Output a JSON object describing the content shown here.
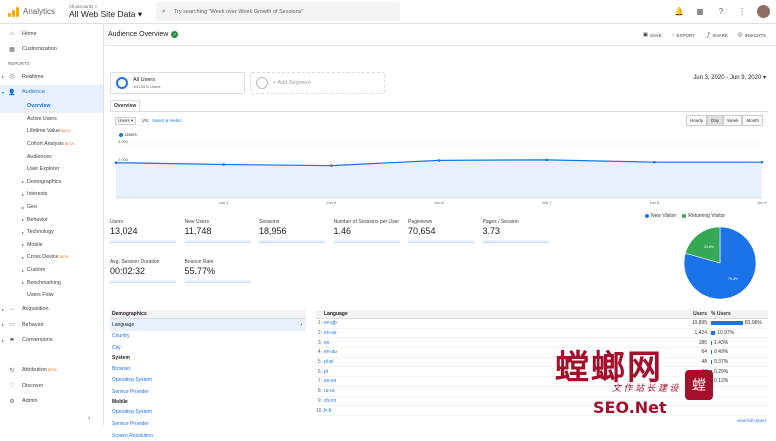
{
  "app": {
    "name": "Analytics",
    "account_path": "All accounts >",
    "view": "All Web Site Data",
    "search_placeholder": "Try searching \"Week over Week Growth of Sessions\""
  },
  "topicons": {
    "bell": "🔔",
    "grid": "▦",
    "help": "?",
    "more": "⋮"
  },
  "sidebar": {
    "top": [
      {
        "label": "Home",
        "icon": "⌂"
      },
      {
        "label": "Customization",
        "icon": "▦"
      }
    ],
    "reports_label": "REPORTS",
    "realtime": {
      "label": "Realtime",
      "icon": "◷"
    },
    "audience": {
      "label": "Audience",
      "icon": "👤"
    },
    "audience_items": [
      "Overview",
      "Active Users",
      "Lifetime Value",
      "Cohort Analysis",
      "Audiences",
      "User Explorer",
      "Demographics",
      "Interests",
      "Geo",
      "Behavior",
      "Technology",
      "Mobile",
      "Cross Device",
      "Custom",
      "Benchmarking",
      "Users Flow"
    ],
    "beta": "BETA",
    "others": [
      {
        "label": "Acquisition",
        "icon": "→"
      },
      {
        "label": "Behavior",
        "icon": "▭"
      },
      {
        "label": "Conversions",
        "icon": "⚑"
      }
    ],
    "bottom": [
      {
        "label": "Attribution",
        "icon": "↻"
      },
      {
        "label": "Discover",
        "icon": "♡"
      },
      {
        "label": "Admin",
        "icon": "⚙"
      }
    ]
  },
  "header": {
    "title": "Audience Overview",
    "check": "✓",
    "actions": [
      "SAVE",
      "EXPORT",
      "SHARE",
      "INSIGHTS"
    ],
    "action_icons": [
      "▣",
      "↓",
      "⤴",
      "◎"
    ]
  },
  "segments": {
    "all_users": "All Users",
    "all_users_pct": "100.00% Users",
    "add": "+ Add Segment"
  },
  "date_range": "Jun 3, 2020 - Jun 9, 2020",
  "tab": "Overview",
  "chart_controls": {
    "metric": "Users ▾",
    "vs": "VS.",
    "select_metric": "Select a metric",
    "granularity": [
      "Hourly",
      "Day",
      "Week",
      "Month"
    ],
    "legend": "Users"
  },
  "chart_data": {
    "type": "line",
    "x": [
      "Jun 3",
      "Jun 4",
      "Jun 5",
      "Jun 6",
      "Jun 7",
      "Jun 8",
      "Jun 9"
    ],
    "series": [
      {
        "name": "Users",
        "values": [
          1960,
          1860,
          1800,
          2090,
          2120,
          1990,
          1990
        ]
      }
    ],
    "yticks": [
      "3,000",
      "2,000",
      "1,000"
    ],
    "xticks": [
      "Jun 4",
      "Jun 5",
      "Jun 6",
      "Jun 7",
      "Jun 8",
      "Jun 9"
    ],
    "ylim": [
      0,
      3000
    ],
    "color": "#1a73e8"
  },
  "metrics": [
    {
      "label": "Users",
      "value": "13,024"
    },
    {
      "label": "New Users",
      "value": "11,748"
    },
    {
      "label": "Sessions",
      "value": "18,956"
    },
    {
      "label": "Number of Sessions per User",
      "value": "1.46"
    },
    {
      "label": "Pageviews",
      "value": "70,654"
    },
    {
      "label": "Pages / Session",
      "value": "3.73"
    },
    {
      "label": "Avg. Session Duration",
      "value": "00:02:32"
    },
    {
      "label": "Bounce Rate",
      "value": "55.77%"
    }
  ],
  "pie": {
    "legend": [
      "New Visitor",
      "Returning Visitor"
    ],
    "values": [
      79.4,
      20.6
    ],
    "labels": [
      "79.4%",
      "20.6%"
    ],
    "colors": [
      "#1a73e8",
      "#34a853"
    ]
  },
  "dimensions": {
    "demographics": "Demographics",
    "language": "Language",
    "country": "Country",
    "city": "City",
    "system": "System",
    "browser": "Browser",
    "os": "Operating System",
    "sp": "Service Provider",
    "mobile": "Mobile",
    "mos": "Operating System",
    "msp": "Service Provider",
    "res": "Screen Resolution"
  },
  "lang_table": {
    "headers": [
      "Language",
      "Users",
      "% Users"
    ],
    "rows": [
      {
        "n": "1.",
        "lang": "en-gb",
        "users": "10,895",
        "pct": "83.96%",
        "frac": 0.8396
      },
      {
        "n": "2.",
        "lang": "en-us",
        "users": "1,424",
        "pct": "10.97%",
        "frac": 0.1097
      },
      {
        "n": "3.",
        "lang": "es",
        "users": "186",
        "pct": "1.43%",
        "frac": 0.0143
      },
      {
        "n": "4.",
        "lang": "en-au",
        "users": "64",
        "pct": "0.49%",
        "frac": 0.0049
      },
      {
        "n": "5.",
        "lang": "pl-pl",
        "users": "48",
        "pct": "0.37%",
        "frac": 0.0037
      },
      {
        "n": "6.",
        "lang": "pl",
        "users": "37",
        "pct": "0.29%",
        "frac": 0.0029
      },
      {
        "n": "7.",
        "lang": "es-es",
        "users": "16",
        "pct": "0.12%",
        "frac": 0.0012
      },
      {
        "n": "8.",
        "lang": "ru-ru",
        "users": "",
        "pct": "",
        "frac": 0
      },
      {
        "n": "9.",
        "lang": "zh-cn",
        "users": "",
        "pct": "",
        "frac": 0
      },
      {
        "n": "10.",
        "lang": "fr-fr",
        "users": "",
        "pct": "",
        "frac": 0
      }
    ],
    "view_full": "view full report"
  },
  "watermark": {
    "main": "螳螂网",
    "sub": "文 作 站 长 建 设",
    "url": "SEO.Net",
    "seal": "螳"
  }
}
